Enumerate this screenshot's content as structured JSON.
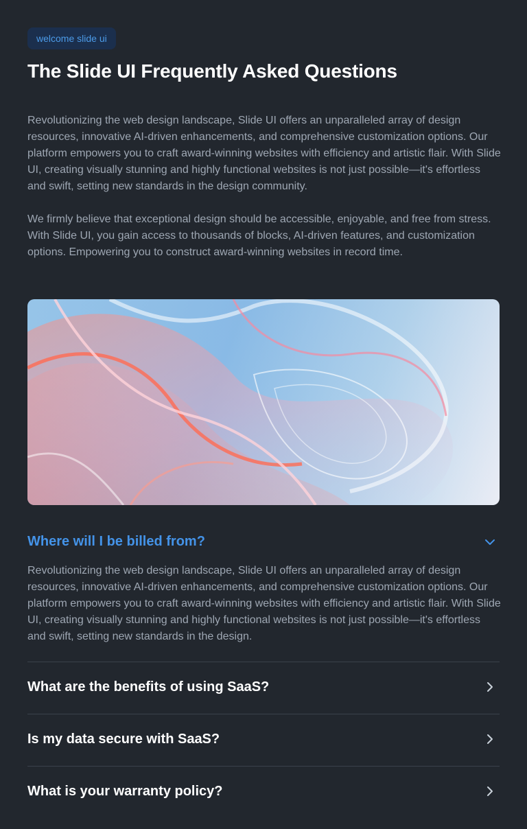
{
  "badge": "welcome slide ui",
  "title": "The Slide UI Frequently Asked Questions",
  "intro": [
    "Revolutionizing the web design landscape, Slide UI offers an unparalleled array of design resources, innovative AI-driven enhancements, and comprehensive customization options. Our platform empowers you to craft award-winning websites with efficiency and artistic flair. With Slide UI, creating visually stunning and highly functional websites is not just possible—it's effortless and swift, setting new standards in the design community.",
    "We firmly believe that exceptional design should be accessible, enjoyable, and free from stress. With Slide UI, you gain access to thousands of blocks, AI-driven features, and customization options. Empowering you to construct award-winning websites in record time."
  ],
  "colors": {
    "background": "#22272e",
    "accent": "#4493e8",
    "badge_bg": "#1b2f4d",
    "body_text": "#9ea7b3"
  },
  "faq": {
    "open": {
      "question": "Where will I be billed from?",
      "answer": "Revolutionizing the web design landscape, Slide UI offers an unparalleled array of design resources, innovative AI-driven enhancements, and comprehensive customization options. Our platform empowers you to craft award-winning websites with efficiency and artistic flair. With Slide UI, creating visually stunning and highly functional websites is not just possible—it's effortless and swift, setting new standards in the design.",
      "icon": "chevron-down-icon"
    },
    "items": [
      {
        "question": "What are the benefits of using SaaS?",
        "icon": "chevron-right-icon"
      },
      {
        "question": "Is my data secure with SaaS?",
        "icon": "chevron-right-icon"
      },
      {
        "question": "What is your warranty policy?",
        "icon": "chevron-right-icon"
      }
    ]
  }
}
